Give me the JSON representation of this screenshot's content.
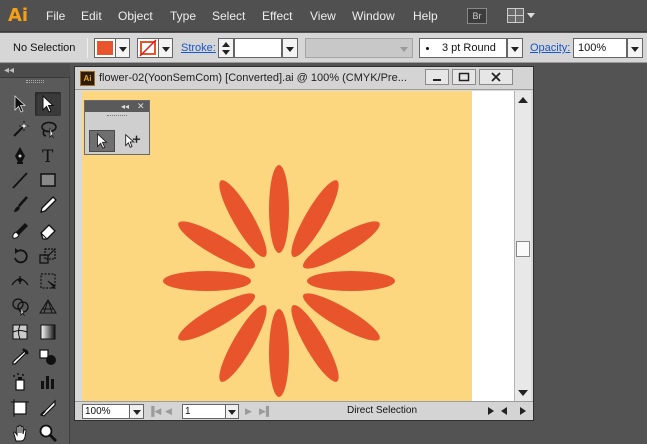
{
  "app": {
    "logo": "Ai"
  },
  "menu": [
    "File",
    "Edit",
    "Object",
    "Type",
    "Select",
    "Effect",
    "View",
    "Window",
    "Help"
  ],
  "menubar_extras": {
    "bridge_label": "Br",
    "arrange_icon": "arrange-documents-icon"
  },
  "control_bar": {
    "selection_label": "No Selection",
    "fill_color": "#e8552c",
    "stroke_label": "Stroke:",
    "stroke_weight": "",
    "brush": "3 pt Round",
    "opacity_label": "Opacity:",
    "opacity_value": "100%"
  },
  "document": {
    "title": "flower-02(YoonSemCom) [Converted].ai @ 100% (CMYK/Pre...",
    "icon_label": "Ai",
    "artboard_color": "#fcd77f",
    "petal_color": "#e8552c",
    "petal_count": 12
  },
  "status_bar": {
    "zoom": "100%",
    "artboard_number": "1",
    "status_text": "Direct Selection"
  },
  "tools": [
    "selection-tool",
    "direct-selection-tool",
    "magic-wand-tool",
    "lasso-tool",
    "pen-tool",
    "type-tool",
    "line-segment-tool",
    "rectangle-tool",
    "paintbrush-tool",
    "pencil-tool",
    "blob-brush-tool",
    "eraser-tool",
    "rotate-tool",
    "scale-tool",
    "width-tool",
    "free-transform-tool",
    "shape-builder-tool",
    "perspective-grid-tool",
    "mesh-tool",
    "gradient-tool",
    "eyedropper-tool",
    "blend-tool",
    "symbol-sprayer-tool",
    "column-graph-tool",
    "artboard-tool",
    "slice-tool",
    "hand-tool",
    "zoom-tool"
  ],
  "float_panel": {
    "tools": [
      "direct-selection-tool",
      "group-selection-tool"
    ]
  }
}
